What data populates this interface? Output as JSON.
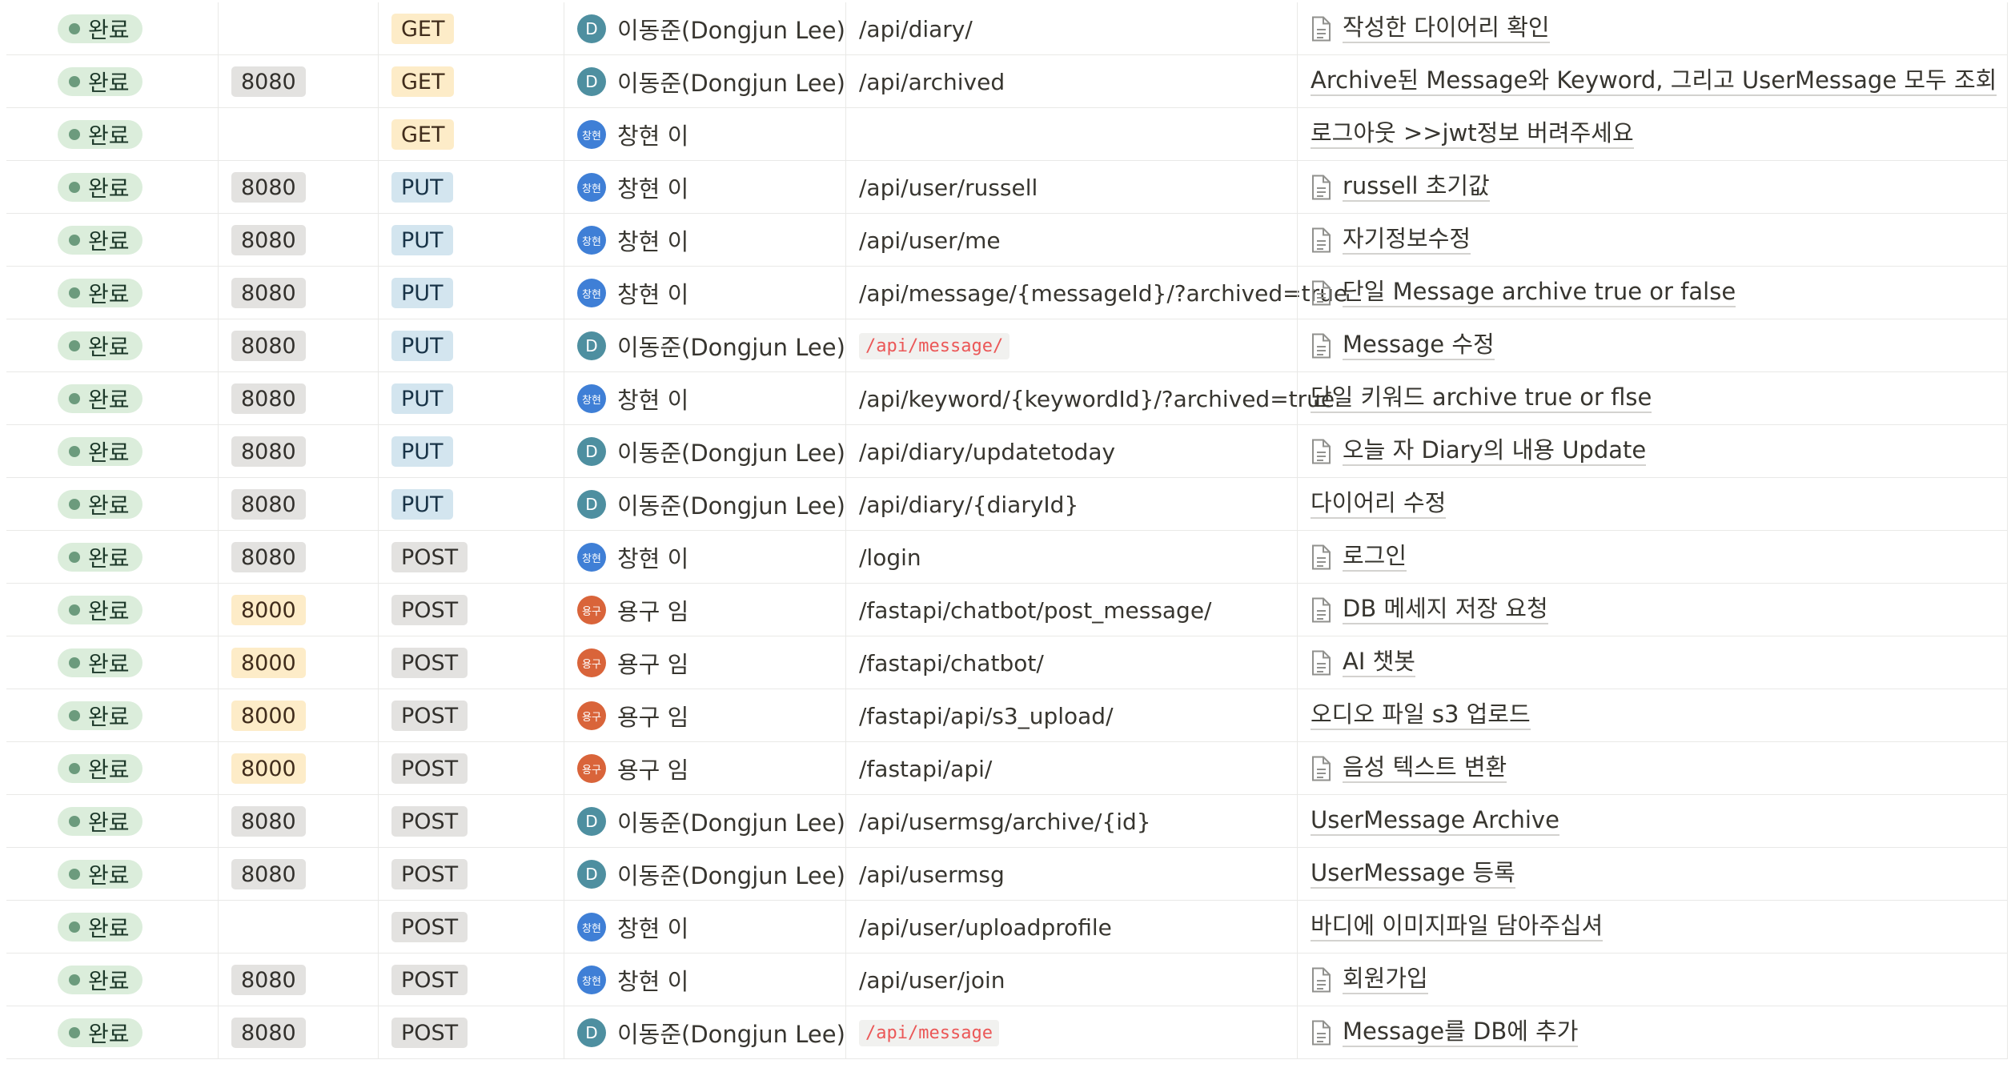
{
  "rows": [
    {
      "status": "완료",
      "port": "",
      "method": "GET",
      "owner": "이동준(Dongjun Lee)",
      "owner_initial": "D",
      "endpoint": "/api/diary/",
      "desc": "작성한 다이어리 확인",
      "doc": true
    },
    {
      "status": "완료",
      "port": "8080",
      "method": "GET",
      "owner": "이동준(Dongjun Lee)",
      "owner_initial": "D",
      "endpoint": "/api/archived",
      "desc": "Archive된 Message와 Keyword, 그리고 UserMessage 모두 조회",
      "doc": false
    },
    {
      "status": "완료",
      "port": "",
      "method": "GET",
      "owner": "창현 이",
      "owner_initial": "창현",
      "endpoint": "",
      "desc": "로그아웃 >>jwt정보 버려주세요",
      "doc": false
    },
    {
      "status": "완료",
      "port": "8080",
      "method": "PUT",
      "owner": "창현 이",
      "owner_initial": "창현",
      "endpoint": "/api/user/russell",
      "desc": "russell 초기값",
      "doc": true
    },
    {
      "status": "완료",
      "port": "8080",
      "method": "PUT",
      "owner": "창현 이",
      "owner_initial": "창현",
      "endpoint": "/api/user/me",
      "desc": "자기정보수정",
      "doc": true
    },
    {
      "status": "완료",
      "port": "8080",
      "method": "PUT",
      "owner": "창현 이",
      "owner_initial": "창현",
      "endpoint": "/api/message/{messageId}/?archived=true",
      "desc": "단일 Message archive true or false",
      "doc": true
    },
    {
      "status": "완료",
      "port": "8080",
      "method": "PUT",
      "owner": "이동준(Dongjun Lee)",
      "owner_initial": "D",
      "endpoint": "/api/message/",
      "endpoint_code": true,
      "desc": "Message 수정",
      "doc": true
    },
    {
      "status": "완료",
      "port": "8080",
      "method": "PUT",
      "owner": "창현 이",
      "owner_initial": "창현",
      "endpoint": "/api/keyword/{keywordId}/?archived=true",
      "desc": "단일 키워드 archive true or flse",
      "doc": false
    },
    {
      "status": "완료",
      "port": "8080",
      "method": "PUT",
      "owner": "이동준(Dongjun Lee)",
      "owner_initial": "D",
      "endpoint": "/api/diary/updatetoday",
      "desc": "오늘 자 Diary의 내용 Update",
      "doc": true
    },
    {
      "status": "완료",
      "port": "8080",
      "method": "PUT",
      "owner": "이동준(Dongjun Lee)",
      "owner_initial": "D",
      "endpoint": "/api/diary/{diaryId}",
      "desc": "다이어리 수정",
      "doc": false
    },
    {
      "status": "완료",
      "port": "8080",
      "method": "POST",
      "owner": "창현 이",
      "owner_initial": "창현",
      "endpoint": "/login",
      "desc": "로그인",
      "doc": true
    },
    {
      "status": "완료",
      "port": "8000",
      "method": "POST",
      "owner": "용구 임",
      "owner_initial": "용구",
      "endpoint": "/fastapi/chatbot/post_message/",
      "desc": "DB 메세지 저장 요청",
      "doc": true
    },
    {
      "status": "완료",
      "port": "8000",
      "method": "POST",
      "owner": "용구 임",
      "owner_initial": "용구",
      "endpoint": "/fastapi/chatbot/",
      "desc": "AI 챗봇",
      "doc": true
    },
    {
      "status": "완료",
      "port": "8000",
      "method": "POST",
      "owner": "용구 임",
      "owner_initial": "용구",
      "endpoint": "/fastapi/api/s3_upload/",
      "desc": "오디오 파일 s3 업로드",
      "doc": false
    },
    {
      "status": "완료",
      "port": "8000",
      "method": "POST",
      "owner": "용구 임",
      "owner_initial": "용구",
      "endpoint": "/fastapi/api/",
      "desc": "음성 텍스트 변환",
      "doc": true
    },
    {
      "status": "완료",
      "port": "8080",
      "method": "POST",
      "owner": "이동준(Dongjun Lee)",
      "owner_initial": "D",
      "endpoint": "/api/usermsg/archive/{id}",
      "desc": "UserMessage Archive",
      "doc": false
    },
    {
      "status": "완료",
      "port": "8080",
      "method": "POST",
      "owner": "이동준(Dongjun Lee)",
      "owner_initial": "D",
      "endpoint": "/api/usermsg",
      "desc": "UserMessage 등록",
      "doc": false
    },
    {
      "status": "완료",
      "port": "",
      "method": "POST",
      "owner": "창현 이",
      "owner_initial": "창현",
      "endpoint": "/api/user/uploadprofile",
      "desc": "바디에 이미지파일 담아주십셔",
      "doc": false
    },
    {
      "status": "완료",
      "port": "8080",
      "method": "POST",
      "owner": "창현 이",
      "owner_initial": "창현",
      "endpoint": "/api/user/join",
      "desc": "회원가입",
      "doc": true
    },
    {
      "status": "완료",
      "port": "8080",
      "method": "POST",
      "owner": "이동준(Dongjun Lee)",
      "owner_initial": "D",
      "endpoint": "/api/message",
      "endpoint_code": true,
      "desc": "Message를 DB에 추가",
      "doc": true
    }
  ]
}
